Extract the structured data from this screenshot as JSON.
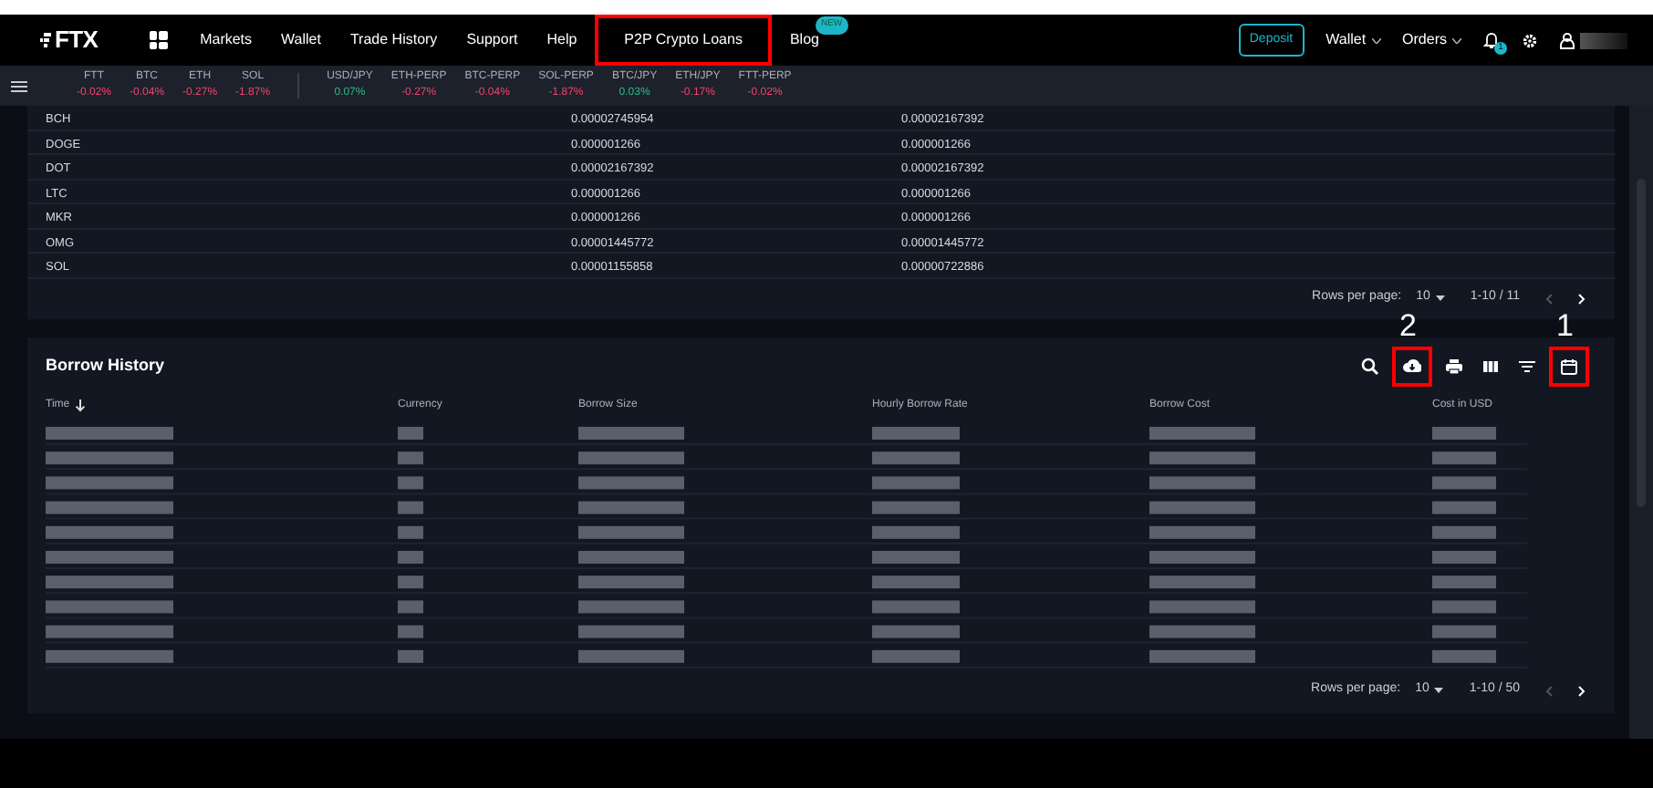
{
  "nav": {
    "logo": "FTX",
    "items": [
      {
        "label": "Markets",
        "highlighted": false
      },
      {
        "label": "Wallet",
        "highlighted": false
      },
      {
        "label": "Trade History",
        "highlighted": false
      },
      {
        "label": "Support",
        "highlighted": false
      },
      {
        "label": "Help",
        "highlighted": false
      },
      {
        "label": "P2P Crypto Loans",
        "highlighted": true
      },
      {
        "label": "Blog",
        "highlighted": false,
        "badge": "NEW"
      }
    ],
    "deposit": "Deposit",
    "menus": [
      "Wallet",
      "Orders"
    ],
    "notification_count": "1"
  },
  "ticker": {
    "groups": [
      [
        {
          "symbol": "FTT",
          "change": "-0.02%",
          "positive": false
        },
        {
          "symbol": "BTC",
          "change": "-0.04%",
          "positive": false
        },
        {
          "symbol": "ETH",
          "change": "-0.27%",
          "positive": false
        },
        {
          "symbol": "SOL",
          "change": "-1.87%",
          "positive": false
        }
      ],
      [
        {
          "symbol": "USD/JPY",
          "change": "0.07%",
          "positive": true
        },
        {
          "symbol": "ETH-PERP",
          "change": "-0.27%",
          "positive": false
        },
        {
          "symbol": "BTC-PERP",
          "change": "-0.04%",
          "positive": false
        },
        {
          "symbol": "SOL-PERP",
          "change": "-1.87%",
          "positive": false
        },
        {
          "symbol": "BTC/JPY",
          "change": "0.03%",
          "positive": true
        },
        {
          "symbol": "ETH/JPY",
          "change": "-0.17%",
          "positive": false
        },
        {
          "symbol": "FTT-PERP",
          "change": "-0.02%",
          "positive": false
        }
      ]
    ]
  },
  "rates_table": {
    "rows": [
      [
        "BCH",
        "0.00002745954",
        "0.00002167392"
      ],
      [
        "DOGE",
        "0.000001266",
        "0.000001266"
      ],
      [
        "DOT",
        "0.00002167392",
        "0.00002167392"
      ],
      [
        "LTC",
        "0.000001266",
        "0.000001266"
      ],
      [
        "MKR",
        "0.000001266",
        "0.000001266"
      ],
      [
        "OMG",
        "0.00001445772",
        "0.00001445772"
      ],
      [
        "SOL",
        "0.00001155858",
        "0.00000722886"
      ]
    ],
    "pagination": {
      "rows_per_page_label": "Rows per page:",
      "rows_per_page": "10",
      "range": "1-10 / 11"
    }
  },
  "borrow_history": {
    "title": "Borrow History",
    "toolbar": [
      {
        "kind": "search"
      },
      {
        "kind": "download",
        "annotation": "2"
      },
      {
        "kind": "print"
      },
      {
        "kind": "columns"
      },
      {
        "kind": "filter"
      },
      {
        "kind": "calendar",
        "annotation": "1"
      }
    ],
    "columns": [
      {
        "label": "Time",
        "sorted": true
      },
      {
        "label": "Currency",
        "sorted": false
      },
      {
        "label": "Borrow Size",
        "sorted": false
      },
      {
        "label": "Hourly Borrow Rate",
        "sorted": false
      },
      {
        "label": "Borrow Cost",
        "sorted": false
      },
      {
        "label": "Cost in USD",
        "sorted": false
      }
    ],
    "pagination": {
      "rows_per_page_label": "Rows per page:",
      "rows_per_page": "10",
      "range": "1-10 / 50"
    }
  }
}
